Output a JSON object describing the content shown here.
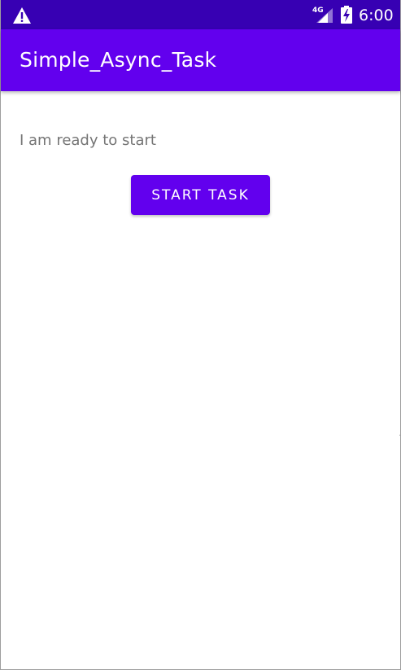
{
  "status_bar": {
    "network_label": "4G",
    "time": "6:00",
    "icons": {
      "warning": "warning-icon",
      "signal": "signal-icon",
      "battery": "battery-charging-icon"
    },
    "background_color": "#3700b3"
  },
  "app_bar": {
    "title": "Simple_Async_Task",
    "background_color": "#6200ee"
  },
  "main": {
    "status_message": "I am ready to start",
    "start_button_label": "START TASK",
    "button_color": "#6200ee"
  }
}
